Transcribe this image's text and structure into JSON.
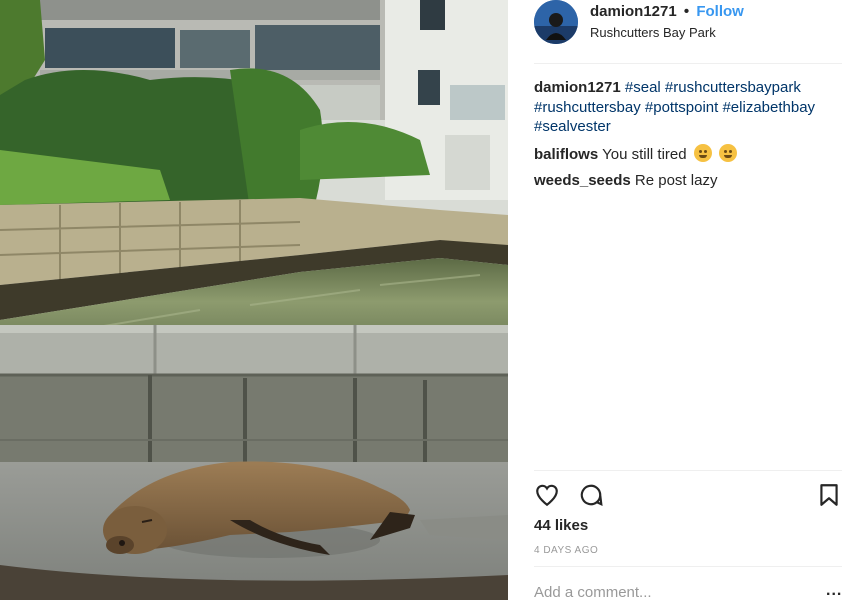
{
  "post": {
    "image_alt": "Seal lying on a harbourside path at Rushcutters Bay Park",
    "header": {
      "username": "damion1271",
      "separator": "•",
      "follow_label": "Follow",
      "location": "Rushcutters Bay Park"
    },
    "caption": {
      "username": "damion1271",
      "hashtags": [
        "#seal",
        "#rushcuttersbaypark",
        "#rushcuttersbay",
        "#pottspoint",
        "#elizabethbay",
        "#sealvester"
      ]
    },
    "comments": [
      {
        "username": "baliflows",
        "text": "You still tired",
        "emojis": [
          "sleepy-face-emoji",
          "grinning-face-emoji"
        ]
      },
      {
        "username": "weeds_seeds",
        "text": "Re post lazy"
      }
    ],
    "likes_text": "44 likes",
    "timestamp": "4 DAYS AGO",
    "comment_placeholder": "Add a comment...",
    "more_label": "..."
  },
  "colors": {
    "link_blue": "#3897f0",
    "hashtag": "#003569",
    "text": "#262626",
    "muted": "#999999",
    "divider": "#efefef"
  },
  "icons": [
    "heart-icon",
    "comment-icon",
    "bookmark-icon",
    "more-options-icon"
  ]
}
